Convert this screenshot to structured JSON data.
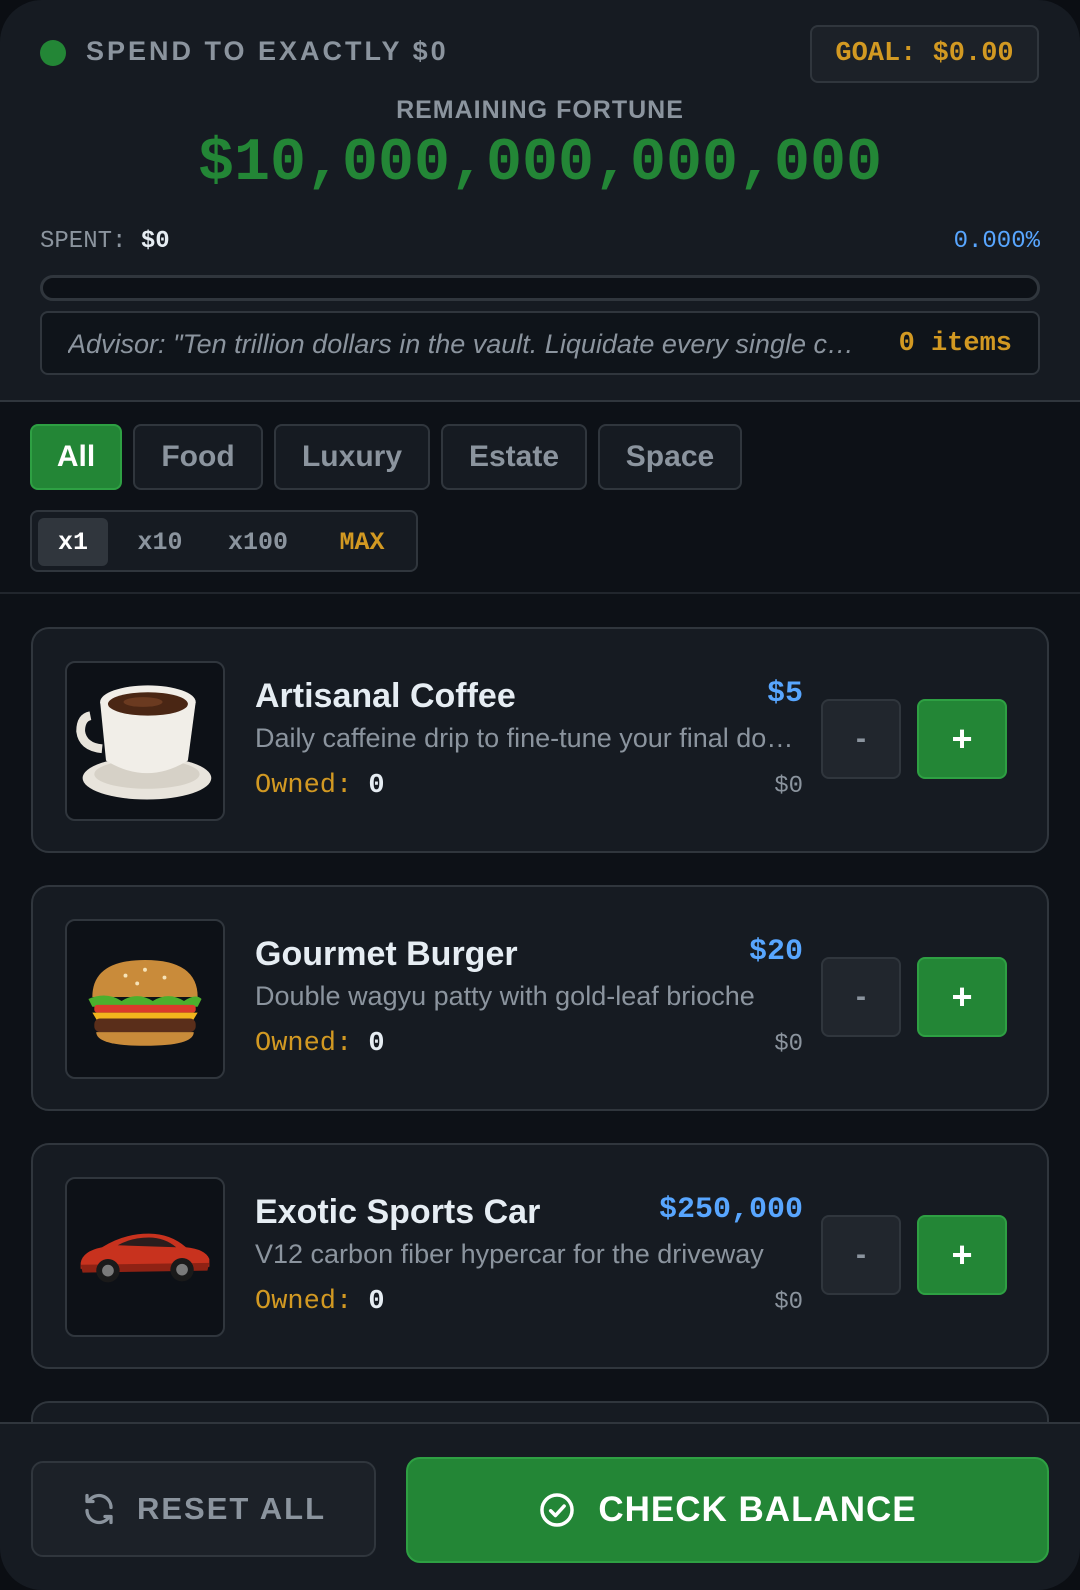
{
  "header": {
    "status_text": "SPEND TO EXACTLY $0",
    "goal_label": "GOAL: $0.00",
    "fortune_label": "REMAINING FORTUNE",
    "fortune_value": "$10,000,000,000,000",
    "spent_label": "SPENT:",
    "spent_value": "$0",
    "percent": "0.000%",
    "progress_fraction": 0,
    "advisor": "Advisor: \"Ten trillion dollars in the vault. Liquidate every single cent.\"",
    "items_count": "0 items"
  },
  "colors": {
    "accent": "#238636",
    "gold": "#d29922",
    "blue": "#58a6ff",
    "bg": "#0d1117"
  },
  "categories": [
    "All",
    "Food",
    "Luxury",
    "Estate",
    "Space"
  ],
  "active_category": "All",
  "multipliers": [
    "x1",
    "x10",
    "x100",
    "MAX"
  ],
  "active_multiplier": "x1",
  "products": [
    {
      "name": "Artisanal Coffee",
      "price": "$5",
      "desc": "Daily caffeine drip to fine-tune your final dollars",
      "owned_label": "Owned:",
      "owned": "0",
      "subtotal": "$0",
      "icon": "coffee-cup-icon",
      "minus": "-",
      "plus": "+"
    },
    {
      "name": "Gourmet Burger",
      "price": "$20",
      "desc": "Double wagyu patty with gold-leaf brioche",
      "owned_label": "Owned:",
      "owned": "0",
      "subtotal": "$0",
      "icon": "burger-icon",
      "minus": "-",
      "plus": "+"
    },
    {
      "name": "Exotic Sports Car",
      "price": "$250,000",
      "desc": "V12 carbon fiber hypercar for the driveway",
      "owned_label": "Owned:",
      "owned": "0",
      "subtotal": "$0",
      "icon": "sports-car-icon",
      "minus": "-",
      "plus": "+"
    }
  ],
  "footer": {
    "reset_label": "RESET ALL",
    "reset_icon": "refresh-icon",
    "check_label": "CHECK BALANCE",
    "check_icon": "check-circle-icon"
  }
}
